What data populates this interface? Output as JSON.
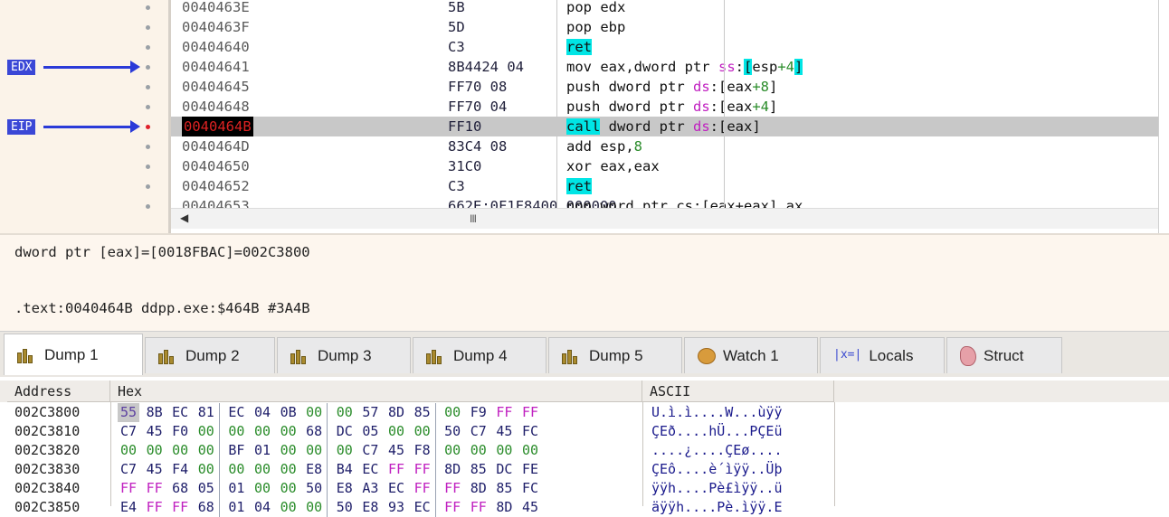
{
  "disassembly": {
    "rows": [
      {
        "addr": "0040463E",
        "bytes": "5B",
        "parts": [
          {
            "t": "pop edx"
          }
        ]
      },
      {
        "addr": "0040463F",
        "bytes": "5D",
        "parts": [
          {
            "t": "pop ebp"
          }
        ]
      },
      {
        "addr": "00404640",
        "bytes": "C3",
        "parts": [
          {
            "t": "ret",
            "c": "kw-hl"
          }
        ]
      },
      {
        "addr": "00404641",
        "bytes": "8B4424 04",
        "parts": [
          {
            "t": "mov eax,dword ptr "
          },
          {
            "t": "ss",
            "c": "seg"
          },
          {
            "t": ":"
          },
          {
            "t": "[",
            "c": "kw-hl"
          },
          {
            "t": "esp"
          },
          {
            "t": "+4",
            "c": "num"
          },
          {
            "t": "]",
            "c": "kw-hl"
          }
        ]
      },
      {
        "addr": "00404645",
        "bytes": "FF70 08",
        "parts": [
          {
            "t": "push dword ptr "
          },
          {
            "t": "ds",
            "c": "seg"
          },
          {
            "t": ":[eax"
          },
          {
            "t": "+8",
            "c": "num"
          },
          {
            "t": "]"
          }
        ]
      },
      {
        "addr": "00404648",
        "bytes": "FF70 04",
        "parts": [
          {
            "t": "push dword ptr "
          },
          {
            "t": "ds",
            "c": "seg"
          },
          {
            "t": ":[eax"
          },
          {
            "t": "+4",
            "c": "num"
          },
          {
            "t": "]"
          }
        ]
      },
      {
        "addr": "0040464B",
        "bytes": "FF10",
        "current": true,
        "parts": [
          {
            "t": "call",
            "c": "kw-hl"
          },
          {
            "t": " dword ptr "
          },
          {
            "t": "ds",
            "c": "seg"
          },
          {
            "t": ":[eax]"
          }
        ]
      },
      {
        "addr": "0040464D",
        "bytes": "83C4 08",
        "parts": [
          {
            "t": "add esp,"
          },
          {
            "t": "8",
            "c": "num"
          }
        ]
      },
      {
        "addr": "00404650",
        "bytes": "31C0",
        "parts": [
          {
            "t": "xor eax,eax"
          }
        ]
      },
      {
        "addr": "00404652",
        "bytes": "C3",
        "parts": [
          {
            "t": "ret",
            "c": "kw-hl"
          }
        ]
      },
      {
        "addr": "00404653",
        "bytes": "662E:0F1F8400 000000",
        "parts": [
          {
            "t": "nop word ptr cs:[eax+eax],ax"
          }
        ]
      }
    ],
    "markers": [
      {
        "label": "EDX",
        "row": 3
      },
      {
        "label": "EIP",
        "row": 6
      }
    ],
    "scroll_grip": "III"
  },
  "info": {
    "line1": "dword ptr [eax]=[0018FBAC]=002C3800",
    "line2": ".text:0040464B ddpp.exe:$464B #3A4B"
  },
  "tabs": [
    {
      "label": "Dump 1",
      "icon": "dump-icon",
      "active": true
    },
    {
      "label": "Dump 2",
      "icon": "dump-icon"
    },
    {
      "label": "Dump 3",
      "icon": "dump-icon"
    },
    {
      "label": "Dump 4",
      "icon": "dump-icon"
    },
    {
      "label": "Dump 5",
      "icon": "dump-icon"
    },
    {
      "label": "Watch 1",
      "icon": "watch-icon"
    },
    {
      "label": "Locals",
      "icon": "locals-icon",
      "glyph": "|x=|"
    },
    {
      "label": "Struct",
      "icon": "struct-icon"
    }
  ],
  "dump": {
    "headers": {
      "address": "Address",
      "hex": "Hex",
      "ascii": "ASCII"
    },
    "rows": [
      {
        "addr": "002C3800",
        "bytes": [
          "55",
          "8B",
          "EC",
          "81",
          "EC",
          "04",
          "0B",
          "00",
          "00",
          "57",
          "8D",
          "85",
          "00",
          "F9",
          "FF",
          "FF"
        ],
        "ascii": "U.ì.ì....W...ùÿÿ"
      },
      {
        "addr": "002C3810",
        "bytes": [
          "C7",
          "45",
          "F0",
          "00",
          "00",
          "00",
          "00",
          "68",
          "DC",
          "05",
          "00",
          "00",
          "50",
          "C7",
          "45",
          "FC"
        ],
        "ascii": "ÇEð....hÜ...PÇEü"
      },
      {
        "addr": "002C3820",
        "bytes": [
          "00",
          "00",
          "00",
          "00",
          "BF",
          "01",
          "00",
          "00",
          "00",
          "C7",
          "45",
          "F8",
          "00",
          "00",
          "00",
          "00"
        ],
        "ascii": "....¿....ÇEø...."
      },
      {
        "addr": "002C3830",
        "bytes": [
          "C7",
          "45",
          "F4",
          "00",
          "00",
          "00",
          "00",
          "E8",
          "B4",
          "EC",
          "FF",
          "FF",
          "8D",
          "85",
          "DC",
          "FE"
        ],
        "ascii": "ÇEô....è´ìÿÿ..Üþ"
      },
      {
        "addr": "002C3840",
        "bytes": [
          "FF",
          "FF",
          "68",
          "05",
          "01",
          "00",
          "00",
          "50",
          "E8",
          "A3",
          "EC",
          "FF",
          "FF",
          "8D",
          "85",
          "FC"
        ],
        "ascii": "ÿÿh....Pè£ìÿÿ..ü"
      },
      {
        "addr": "002C3850",
        "bytes": [
          "E4",
          "FF",
          "FF",
          "68",
          "01",
          "04",
          "00",
          "00",
          "50",
          "E8",
          "93",
          "EC",
          "FF",
          "FF",
          "8D",
          "45"
        ],
        "ascii": "äÿÿh....Pè.ìÿÿ.E"
      }
    ]
  }
}
